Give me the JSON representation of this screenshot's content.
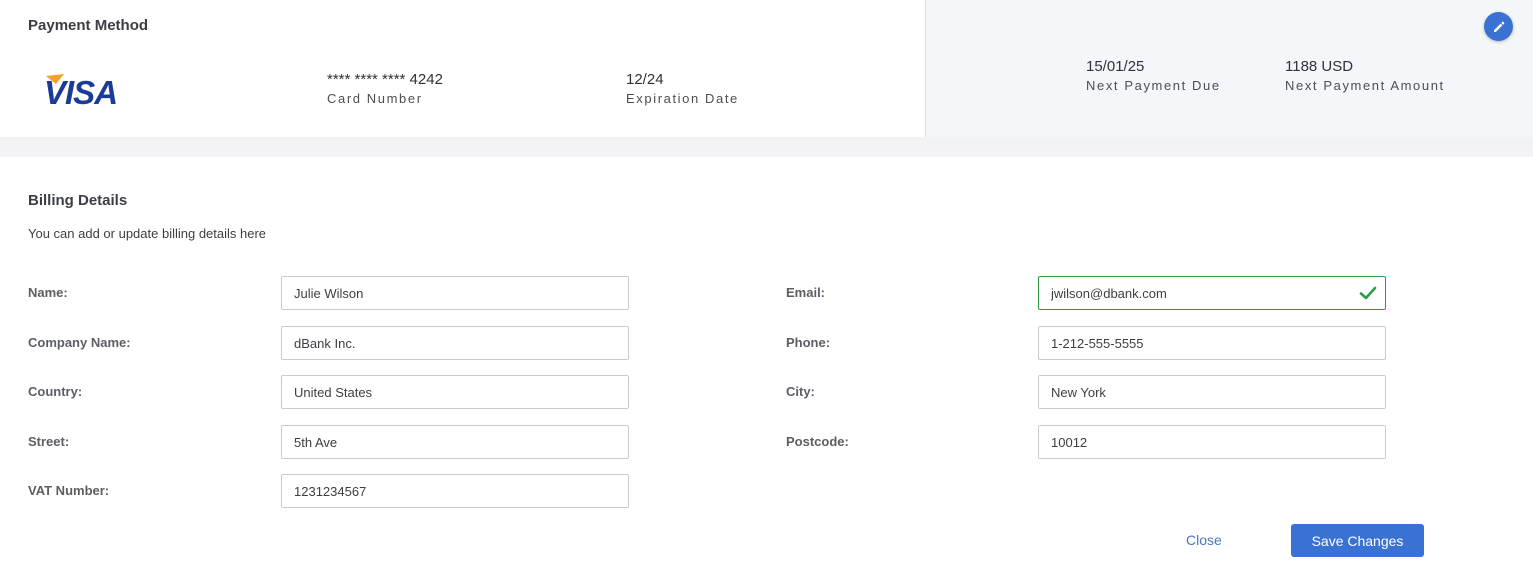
{
  "payment_method": {
    "title": "Payment Method",
    "card_brand": "VISA",
    "card_number": "**** **** **** 4242",
    "card_number_label": "Card Number",
    "expiration_date": "12/24",
    "expiration_date_label": "Expiration Date",
    "next_payment_due": "15/01/25",
    "next_payment_due_label": "Next Payment Due",
    "next_payment_amount": "1188 USD",
    "next_payment_amount_label": "Next Payment Amount",
    "edit_icon": "pencil-icon"
  },
  "billing": {
    "title": "Billing Details",
    "subtitle": "You can add or update billing details here",
    "fields": {
      "name": {
        "label": "Name:",
        "value": "Julie Wilson"
      },
      "company": {
        "label": "Company Name:",
        "value": "dBank Inc."
      },
      "country": {
        "label": "Country:",
        "value": "United States"
      },
      "street": {
        "label": "Street:",
        "value": "5th Ave"
      },
      "vat": {
        "label": "VAT Number:",
        "value": "1231234567"
      },
      "email": {
        "label": "Email:",
        "value": "jwilson@dbank.com",
        "validation_icon": "checkmark-icon"
      },
      "phone": {
        "label": "Phone:",
        "value": "1-212-555-5555"
      },
      "city": {
        "label": "City:",
        "value": "New York"
      },
      "postcode": {
        "label": "Postcode:",
        "value": "10012"
      }
    },
    "close_label": "Close",
    "save_label": "Save Changes"
  },
  "colors": {
    "primary": "#3a72d3",
    "valid": "#2e9c47",
    "panel_background": "#f4f6f9",
    "visa_blue": "#1a3c96",
    "visa_gold": "#f0a32a"
  }
}
